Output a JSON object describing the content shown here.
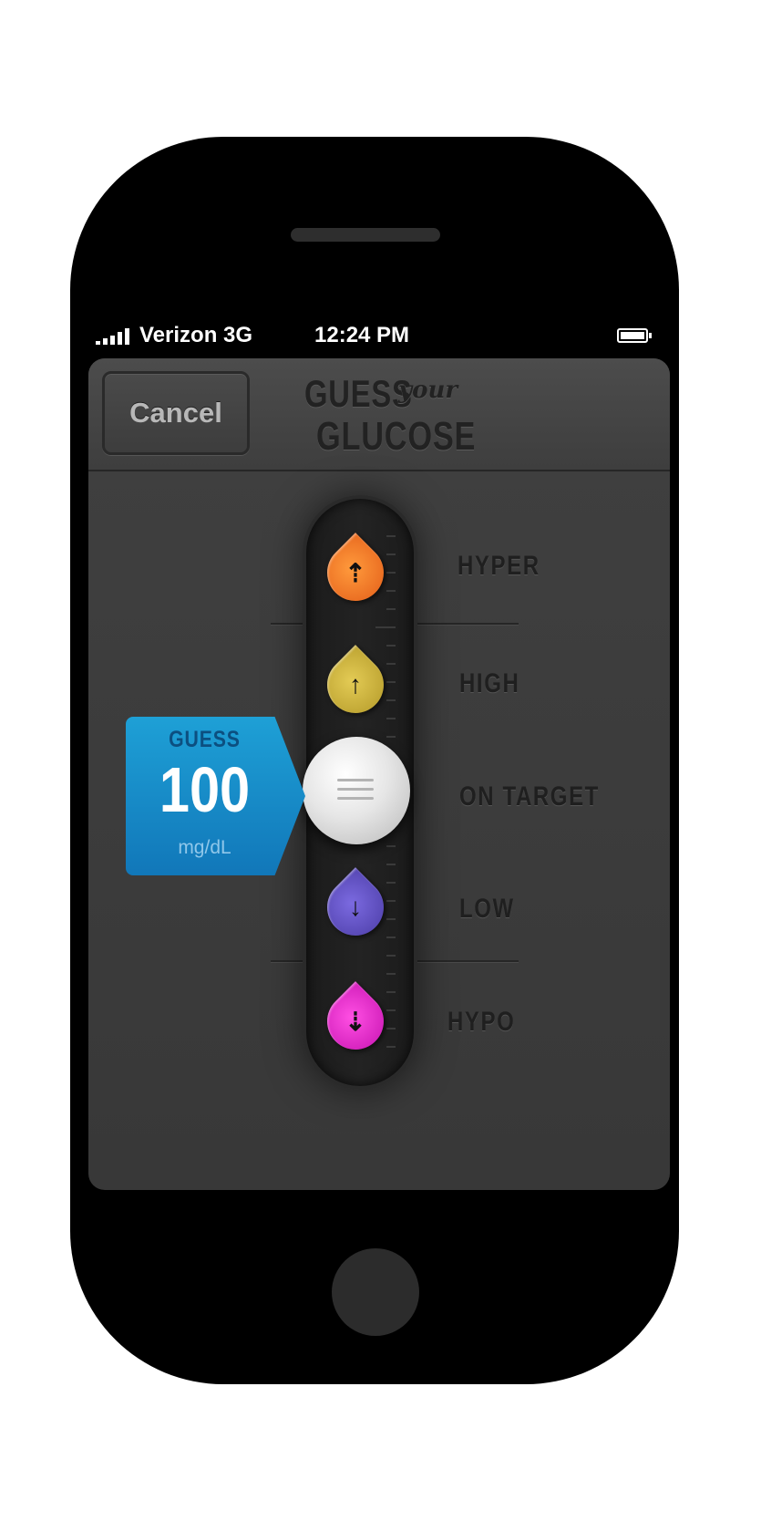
{
  "status_bar": {
    "carrier": "Verizon  3G",
    "time": "12:24 PM"
  },
  "nav": {
    "cancel_label": "Cancel",
    "title_line1": "GUESS",
    "title_script": "your",
    "title_line2": "GLUCOSE"
  },
  "levels": [
    {
      "label": "HYPER",
      "color": "#f07a28",
      "icon": "double-arrow-up-icon"
    },
    {
      "label": "HIGH",
      "color": "#c9b23a",
      "icon": "arrow-up-icon"
    },
    {
      "label": "ON TARGET",
      "color": "#f2f2f2",
      "icon": "slider-knob"
    },
    {
      "label": "LOW",
      "color": "#5b4bc0",
      "icon": "arrow-down-icon"
    },
    {
      "label": "HYPO",
      "color": "#e02ac9",
      "icon": "double-arrow-down-icon"
    }
  ],
  "guess": {
    "label": "GUESS",
    "value": "100",
    "unit": "mg/dL"
  }
}
